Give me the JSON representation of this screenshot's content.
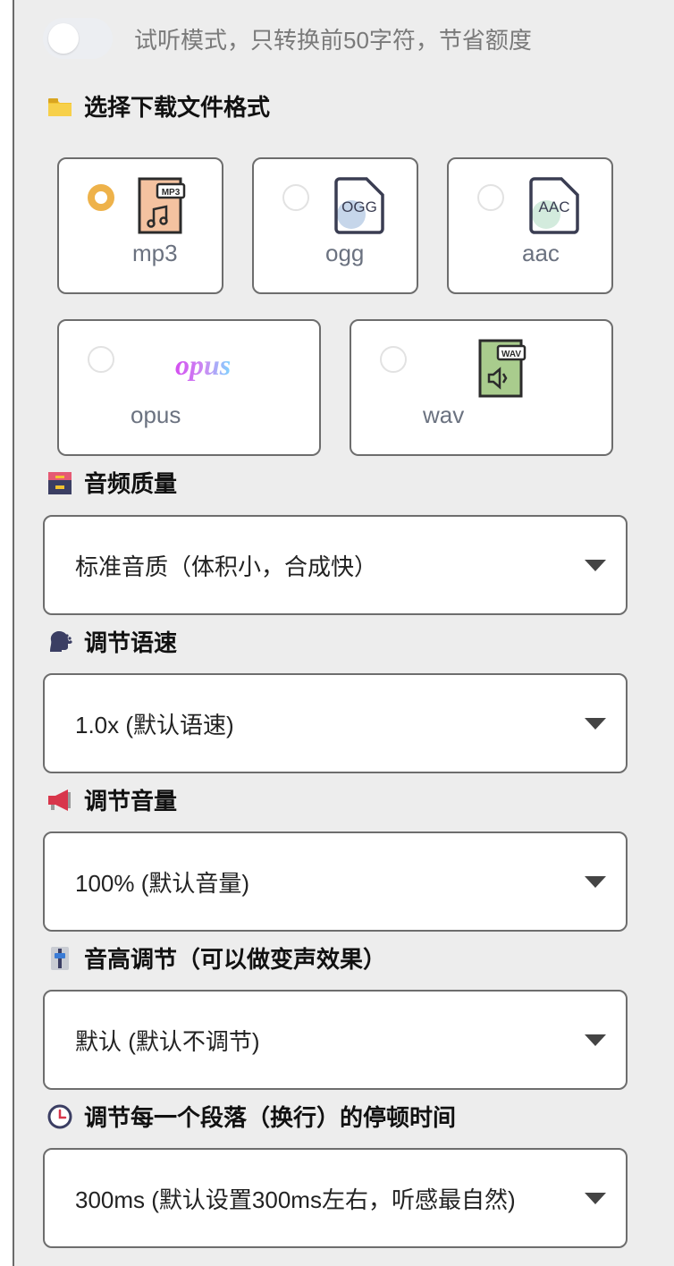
{
  "preview_toggle": {
    "label": "试听模式，只转换前50字符，节省额度",
    "checked": false
  },
  "format_section": {
    "heading": "选择下载文件格式",
    "options": [
      {
        "label": "mp3",
        "icon_text": "MP3",
        "selected": true
      },
      {
        "label": "ogg",
        "icon_text": "OGG",
        "selected": false
      },
      {
        "label": "aac",
        "icon_text": "AAC",
        "selected": false
      },
      {
        "label": "opus",
        "icon_text": "opus",
        "selected": false
      },
      {
        "label": "wav",
        "icon_text": "WAV",
        "selected": false
      }
    ]
  },
  "quality": {
    "heading": "音频质量",
    "value": "标准音质（体积小，合成快）"
  },
  "speed": {
    "heading": "调节语速",
    "value": "1.0x (默认语速)"
  },
  "volume": {
    "heading": "调节音量",
    "value": "100% (默认音量)"
  },
  "pitch": {
    "heading": "音高调节（可以做变声效果）",
    "value": "默认 (默认不调节)"
  },
  "pause": {
    "heading": "调节每一个段落（换行）的停顿时间",
    "value": "300ms (默认设置300ms左右，听感最自然)"
  },
  "colors": {
    "radio_selected": "#eeb24a",
    "border": "#6d6d6d",
    "label_gray": "#6b7280"
  }
}
